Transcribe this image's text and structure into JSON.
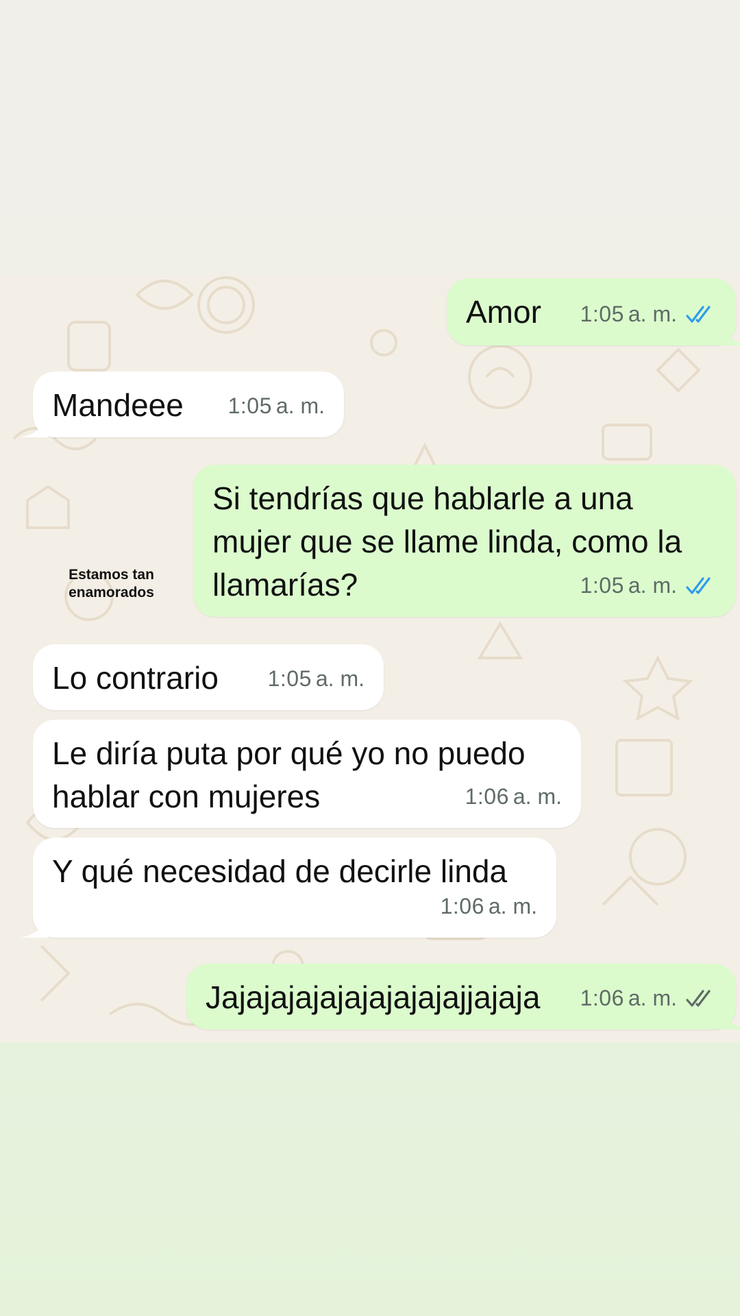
{
  "caption": "Estamos tan\nenamorados",
  "colors": {
    "outgoing_bubble": "#dbfbcd",
    "incoming_bubble": "#ffffff",
    "read_ticks": "#2f9bea",
    "delivered_ticks": "#5f6b66",
    "wallpaper": "#f4efe6"
  },
  "messages": [
    {
      "direction": "outgoing",
      "text": "Amor",
      "time": "1:05",
      "ampm": "a. m.",
      "status": "read",
      "status_icon": "double-check-icon"
    },
    {
      "direction": "incoming",
      "text": "Mandeee",
      "time": "1:05",
      "ampm": "a. m."
    },
    {
      "direction": "outgoing",
      "text": "Si tendrías que hablarle a una\nmujer que se llame linda, como la\nllamarías?",
      "time": "1:05",
      "ampm": "a. m.",
      "status": "read",
      "status_icon": "double-check-icon"
    },
    {
      "direction": "incoming",
      "text": "Lo contrario",
      "time": "1:05",
      "ampm": "a. m."
    },
    {
      "direction": "incoming",
      "text": "Le diría puta por qué yo no puedo\nhablar con mujeres",
      "time": "1:06",
      "ampm": "a. m."
    },
    {
      "direction": "incoming",
      "text": "Y qué necesidad de decirle linda",
      "time": "1:06",
      "ampm": "a. m."
    },
    {
      "direction": "outgoing",
      "text": "Jajajajajajajajajajajjajaja",
      "time": "1:06",
      "ampm": "a. m.",
      "status": "delivered",
      "status_icon": "double-check-icon"
    }
  ]
}
